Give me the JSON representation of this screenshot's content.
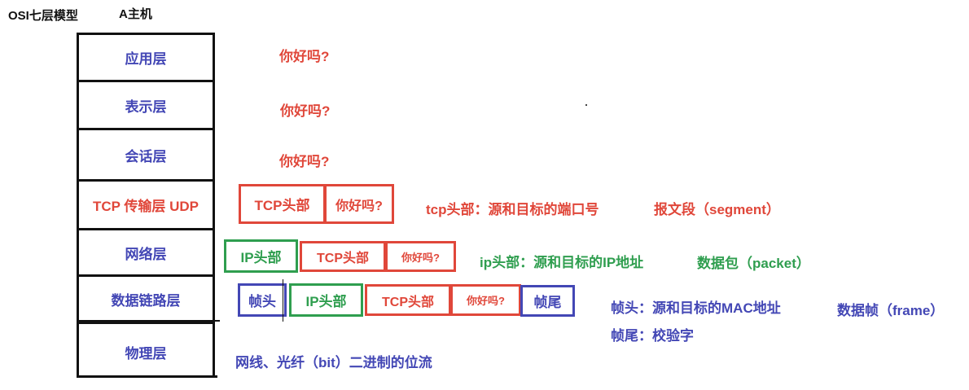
{
  "header": {
    "title": "OSI七层模型",
    "host": "A主机"
  },
  "layers": [
    {
      "label": "应用层"
    },
    {
      "label": "表示层"
    },
    {
      "label": "会话层"
    },
    {
      "label": "TCP 传输层  UDP"
    },
    {
      "label": "网络层"
    },
    {
      "label": "数据链路层"
    },
    {
      "label": "物理层"
    }
  ],
  "messages": {
    "application": "你好吗?",
    "presentation": "你好吗?",
    "session": "你好吗?"
  },
  "transport": {
    "tcp_header": "TCP头部",
    "payload": "你好吗?",
    "note": "tcp头部：源和目标的端口号",
    "unit": "报文段（segment）"
  },
  "network": {
    "ip_header": "IP头部",
    "tcp_header": "TCP头部",
    "payload": "你好吗?",
    "note": "ip头部：源和目标的IP地址",
    "unit": "数据包（packet）"
  },
  "datalink": {
    "frame_header": "帧头",
    "ip_header": "IP头部",
    "tcp_header": "TCP头部",
    "payload": "你好吗?",
    "frame_trailer": "帧尾",
    "note_header": "帧头：源和目标的MAC地址",
    "note_trailer": "帧尾：校验字",
    "unit": "数据帧（frame）"
  },
  "physical": {
    "note": "网线、光纤（bit）二进制的位流"
  },
  "colors": {
    "blue": "#4347b5",
    "red": "#e0473a",
    "green": "#2f9e4f",
    "black": "#111111"
  }
}
